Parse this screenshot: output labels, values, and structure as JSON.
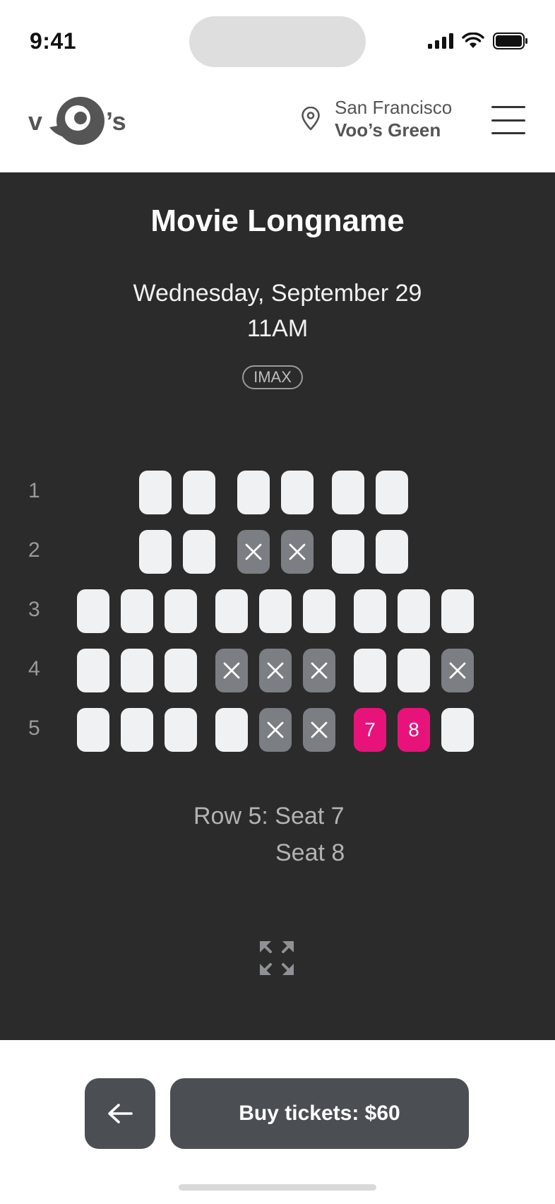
{
  "status": {
    "time": "9:41"
  },
  "header": {
    "logo_left": "v",
    "logo_right": "’s",
    "city": "San Francisco",
    "theater": "Voo’s Green"
  },
  "movie": {
    "title": "Movie Longname",
    "date": "Wednesday, September 29",
    "time": "11AM",
    "format": "IMAX"
  },
  "seat_map": {
    "rows": [
      {
        "label": "1",
        "seats": [
          "available",
          "available",
          "available",
          "available",
          "available",
          "available"
        ]
      },
      {
        "label": "2",
        "seats": [
          "available",
          "available",
          "taken",
          "taken",
          "available",
          "available"
        ]
      },
      {
        "label": "3",
        "seats": [
          "available",
          "available",
          "available",
          "available",
          "available",
          "available",
          "available",
          "available",
          "available"
        ]
      },
      {
        "label": "4",
        "seats": [
          "available",
          "available",
          "available",
          "taken",
          "taken",
          "taken",
          "available",
          "available",
          "taken"
        ]
      },
      {
        "label": "5",
        "seats": [
          "available",
          "available",
          "available",
          "available",
          "taken",
          "taken",
          "selected",
          "selected",
          "available"
        ],
        "seat_numbers": [
          "",
          "",
          "",
          "",
          "",
          "",
          "7",
          "8",
          ""
        ]
      }
    ]
  },
  "selection": {
    "line1": "Row 5: Seat 7",
    "line2": "Seat 8"
  },
  "actions": {
    "buy_label": "Buy tickets: $60"
  },
  "colors": {
    "accent": "#e8137a",
    "panel": "#2b2b2b",
    "seat_available": "#f0f1f2",
    "seat_taken": "#7b7e82",
    "button": "#4b4e52"
  }
}
